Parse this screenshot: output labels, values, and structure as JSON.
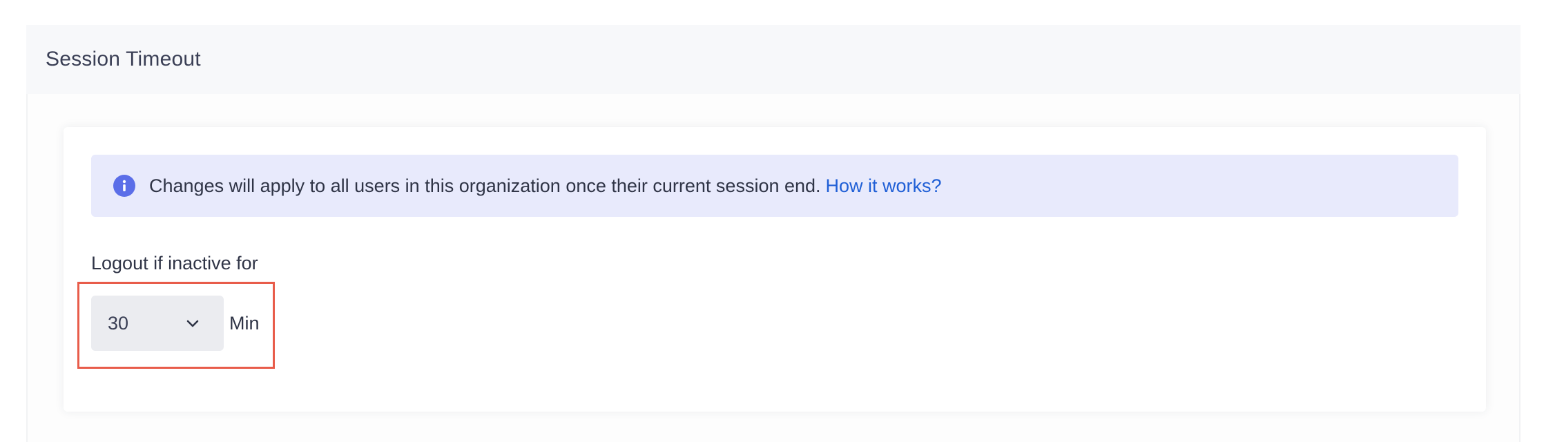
{
  "section": {
    "title": "Session Timeout"
  },
  "banner": {
    "icon": "info-icon",
    "message": "Changes will apply to all users in this organization once their current session end.",
    "link_label": "How it works?"
  },
  "timeout": {
    "label": "Logout if inactive for",
    "selected_value": "30",
    "unit": "Min",
    "dropdown_icon": "chevron-down-icon"
  },
  "colors": {
    "banner_bg": "#e8eafc",
    "info_icon": "#5b6ee8",
    "link": "#1f5fd6",
    "highlight_border": "#e85c4a",
    "select_bg": "#ebecf0"
  }
}
